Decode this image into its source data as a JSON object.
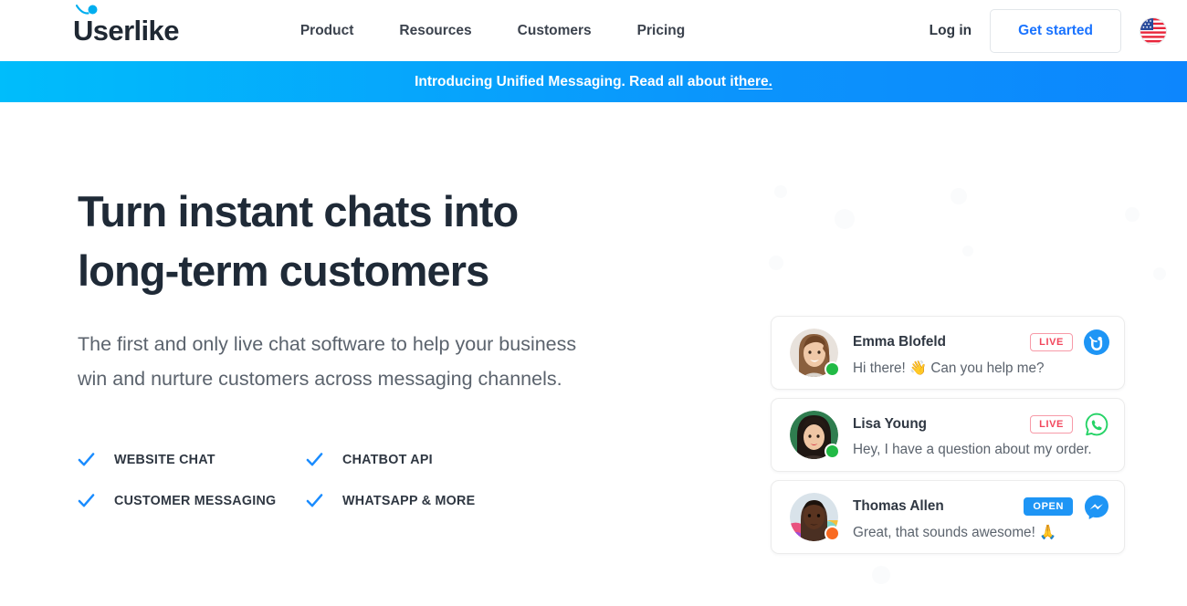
{
  "header": {
    "logo_text": "Userlike",
    "logo_icon": "userlike-swoosh-icon",
    "nav": [
      {
        "label": "Product"
      },
      {
        "label": "Resources"
      },
      {
        "label": "Customers"
      },
      {
        "label": "Pricing"
      }
    ],
    "login_label": "Log in",
    "cta_label": "Get started",
    "flag_icon": "us-flag-icon",
    "flag_alt": "United States"
  },
  "banner": {
    "text_before": "Introducing Unified Messaging. Read all about it ",
    "link_text": "here.",
    "gradient_from": "#00bdfb",
    "gradient_to": "#0d86fd"
  },
  "hero": {
    "headline_line1": "Turn instant chats into",
    "headline_line2": "long-term customers",
    "subheadline": "The first and only live chat software to help your business win and nurture customers across messaging channels.",
    "features": [
      {
        "label": "WEBSITE CHAT",
        "icon": "check-icon"
      },
      {
        "label": "CHATBOT API",
        "icon": "check-icon"
      },
      {
        "label": "CUSTOMER MESSAGING",
        "icon": "check-icon"
      },
      {
        "label": "WHATSAPP & MORE",
        "icon": "check-icon"
      }
    ]
  },
  "chats": [
    {
      "name": "Emma Blofeld",
      "message": "Hi there! 👋 Can you help me?",
      "badge": "LIVE",
      "badge_style": "outline",
      "status": "online",
      "status_color": "#21ba45",
      "channel": "userlike-icon",
      "avatar_alt": "Emma Blofeld avatar"
    },
    {
      "name": "Lisa Young",
      "message": "Hey, I have a question about my order.",
      "badge": "LIVE",
      "badge_style": "outline",
      "status": "online",
      "status_color": "#21ba45",
      "channel": "whatsapp-icon",
      "avatar_alt": "Lisa Young avatar"
    },
    {
      "name": "Thomas Allen",
      "message": "Great, that sounds awesome! 🙏",
      "badge": "OPEN",
      "badge_style": "filled",
      "status": "away",
      "status_color": "#f96a21",
      "channel": "messenger-icon",
      "avatar_alt": "Thomas Allen avatar"
    }
  ],
  "colors": {
    "brand_blue": "#1a73ff",
    "cyan": "#00bdfb",
    "text_dark": "#1f2a37",
    "text_muted": "#5b636d",
    "live_red": "#f2465c",
    "open_blue": "#1e95f5",
    "whatsapp_green": "#25d366",
    "messenger_blue": "#1e95f5"
  }
}
